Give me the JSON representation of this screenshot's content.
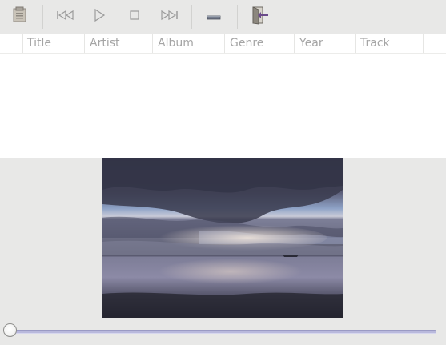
{
  "toolbar": {
    "buttons": [
      {
        "name": "playlist-icon"
      },
      {
        "name": "previous-track-icon"
      },
      {
        "name": "play-icon"
      },
      {
        "name": "stop-icon"
      },
      {
        "name": "next-track-icon"
      },
      {
        "name": "volume-icon"
      },
      {
        "name": "exit-icon"
      }
    ]
  },
  "playlist": {
    "columns": [
      "Title",
      "Artist",
      "Album",
      "Genre",
      "Year",
      "Track"
    ],
    "rows": []
  },
  "video": {
    "scene": "sunset-over-water"
  },
  "seek": {
    "position": 0
  }
}
